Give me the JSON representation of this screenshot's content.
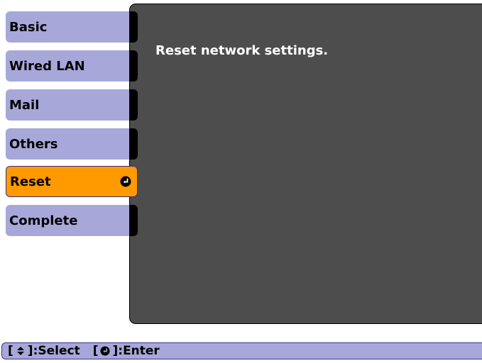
{
  "menu": {
    "items": [
      {
        "label": "Basic"
      },
      {
        "label": "Wired LAN"
      },
      {
        "label": "Mail"
      },
      {
        "label": "Others"
      },
      {
        "label": "Reset",
        "selected": true
      },
      {
        "label": "Complete"
      }
    ]
  },
  "panel": {
    "message": "Reset network settings."
  },
  "footer": {
    "select_label": ":Select",
    "enter_label": ":Enter",
    "left_bracket": "[",
    "right_bracket": "]"
  },
  "colors": {
    "menu_inactive": "#a7a8d9",
    "menu_active": "#ff9a00",
    "panel_background": "#4d4d4d",
    "footer_background": "#a7a8d9"
  },
  "icons": {
    "enter": "enter-icon",
    "updown": "up-down-arrow-icon"
  }
}
